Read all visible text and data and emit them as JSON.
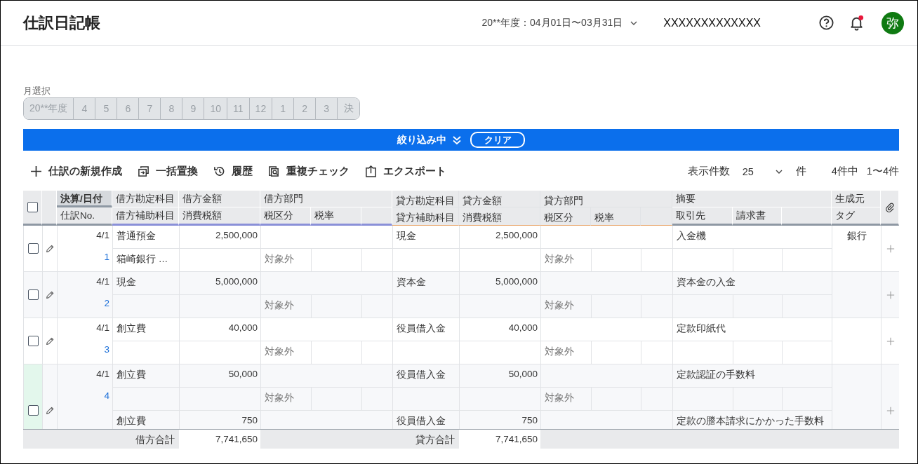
{
  "header": {
    "title": "仕訳日記帳",
    "period": "20**年度：04月01日〜03月31日",
    "company": "XXXXXXXXXXXXX",
    "notification_unread": true,
    "avatar": "弥"
  },
  "month_selector": {
    "label": "月選択",
    "disabled": true,
    "months": [
      "20**年度",
      "4",
      "5",
      "6",
      "7",
      "8",
      "9",
      "10",
      "11",
      "12",
      "1",
      "2",
      "3",
      "決"
    ]
  },
  "filter_bar": {
    "status": "絞り込み中",
    "clear": "クリア"
  },
  "toolbar": {
    "actions": [
      {
        "kind": "new",
        "label": "仕訳の新規作成"
      },
      {
        "kind": "replace",
        "label": "一括置換"
      },
      {
        "kind": "history",
        "label": "履歴"
      },
      {
        "kind": "duplicate",
        "label": "重複チェック"
      },
      {
        "kind": "export",
        "label": "エクスポート"
      }
    ],
    "page_size_label": "表示件数",
    "page_size": "25",
    "page_size_unit": "件",
    "total": "4件中",
    "range": "1〜4件"
  },
  "table": {
    "all_checked": false,
    "top_headers": [
      {
        "label": "決算/日付",
        "sorted": true
      },
      {
        "label": "借方勘定科目",
        "sorted": false
      },
      {
        "label": "借方金額",
        "sorted": false
      },
      {
        "label": "借方部門",
        "sorted": false
      },
      {
        "label": "貸方勘定科目",
        "sorted": false
      },
      {
        "label": "貸方金額",
        "sorted": false
      },
      {
        "label": "貸方部門",
        "sorted": false
      },
      {
        "label": "摘要",
        "sorted": false
      },
      {
        "label": "生成元",
        "sorted": false
      }
    ],
    "bottom_headers": [
      "仕訳No.",
      "借方補助科目",
      "消費税額",
      "税区分",
      "税率",
      "貸方補助科目",
      "消費税額",
      "税区分",
      "税率",
      "取引先",
      "請求書",
      "タグ"
    ],
    "entries": [
      {
        "checked": false,
        "highlighted": false,
        "date": "4/1",
        "no": "1",
        "source": "銀行",
        "lines": [
          {
            "debit_account": "普通預金",
            "debit_sub": "箱崎銀行 …",
            "debit_amount": "2,500,000",
            "debit_tax_class": "対象外",
            "credit_account": "現金",
            "credit_amount": "2,500,000",
            "credit_tax_class": "対象外",
            "summary": "入金機"
          }
        ]
      },
      {
        "checked": false,
        "highlighted": false,
        "date": "4/1",
        "no": "2",
        "lines": [
          {
            "debit_account": "現金",
            "debit_amount": "5,000,000",
            "debit_tax_class": "対象外",
            "credit_account": "資本金",
            "credit_amount": "5,000,000",
            "credit_tax_class": "対象外",
            "summary": "資本金の入金"
          }
        ]
      },
      {
        "checked": false,
        "highlighted": false,
        "date": "4/1",
        "no": "3",
        "lines": [
          {
            "debit_account": "創立費",
            "debit_amount": "40,000",
            "debit_tax_class": "対象外",
            "credit_account": "役員借入金",
            "credit_amount": "40,000",
            "credit_tax_class": "対象外",
            "summary": "定款印紙代"
          }
        ]
      },
      {
        "checked": false,
        "highlighted": true,
        "date": "4/1",
        "no": "4",
        "lines": [
          {
            "debit_account": "創立費",
            "debit_amount": "50,000",
            "debit_tax_class": "対象外",
            "credit_account": "役員借入金",
            "credit_amount": "50,000",
            "credit_tax_class": "対象外",
            "summary": "定款認証の手数料"
          },
          {
            "debit_account": "創立費",
            "debit_amount": "750",
            "credit_account": "役員借入金",
            "credit_amount": "750",
            "summary": "定款の謄本請求にかかった手数料"
          }
        ]
      }
    ],
    "footer": {
      "debit_label": "借方合計",
      "debit_total": "7,741,650",
      "credit_label": "貸方合計",
      "credit_total": "7,741,650"
    }
  }
}
